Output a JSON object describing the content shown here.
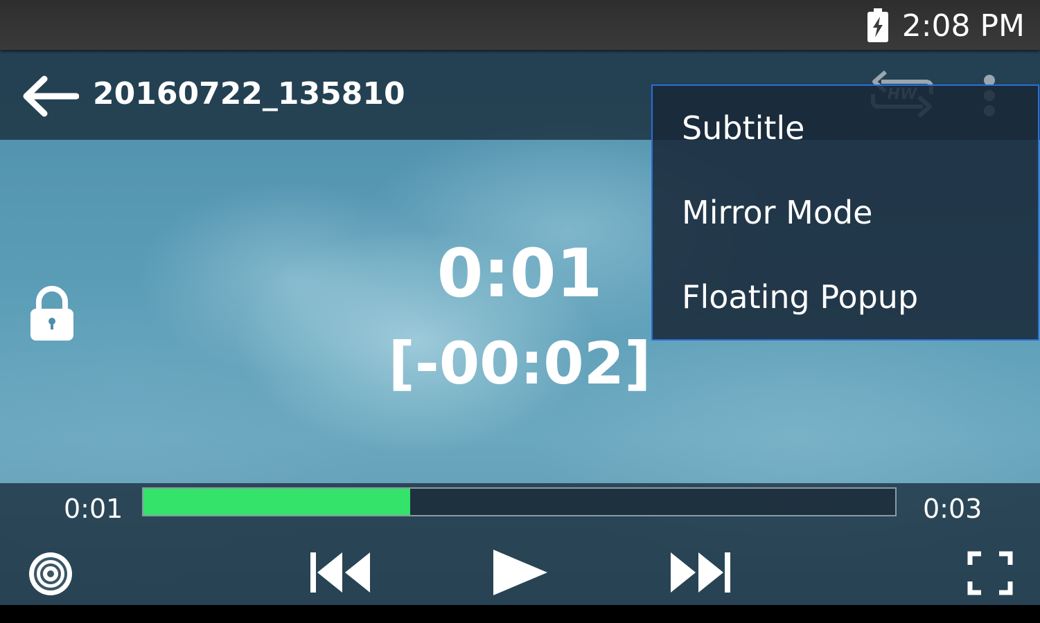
{
  "status_bar": {
    "time": "2:08 PM",
    "battery_icon": "battery-charging-icon"
  },
  "top_bar": {
    "title": "20160722_135810",
    "back_icon": "back-arrow-icon",
    "hw_icon_label": "HW",
    "more_icon": "more-vertical-icon"
  },
  "menu": {
    "items": [
      {
        "label": "Subtitle"
      },
      {
        "label": "Mirror Mode"
      },
      {
        "label": "Floating Popup"
      }
    ],
    "border_color": "#2a6fd6"
  },
  "overlay": {
    "current_time": "0:01",
    "remaining_time": "[-00:02]",
    "lock_icon": "lock-icon"
  },
  "player": {
    "elapsed": "0:01",
    "total": "0:03",
    "progress_fraction": 0.355,
    "progress_color": "#33e36a",
    "controls": [
      "target-icon",
      "skip-previous-icon",
      "play-icon",
      "skip-next-icon",
      "fullscreen-icon"
    ]
  }
}
